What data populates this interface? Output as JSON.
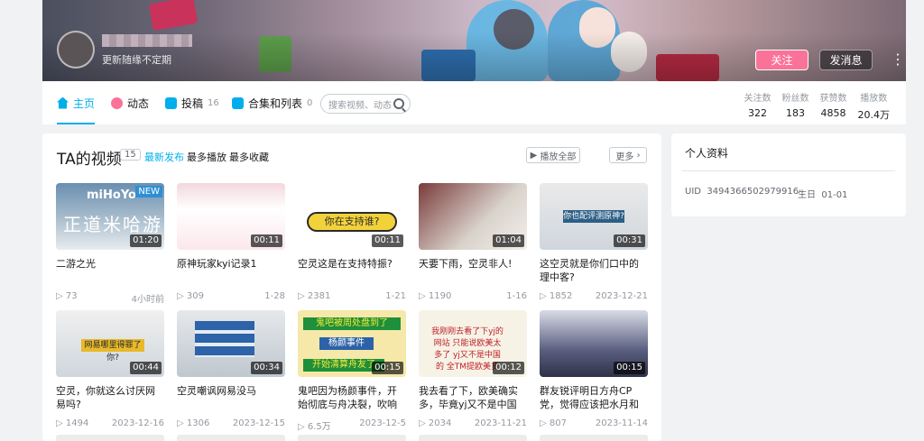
{
  "header": {
    "signature": "更新随缘不定期",
    "follow_label": "关注",
    "message_label": "发消息",
    "more_icon": "more-vertical-icon"
  },
  "nav": {
    "tabs": [
      {
        "label": "主页",
        "count": "",
        "icon": "home-icon",
        "active": true
      },
      {
        "label": "动态",
        "count": "",
        "icon": "dynamic-icon",
        "active": false
      },
      {
        "label": "投稿",
        "count": "16",
        "icon": "upload-icon",
        "active": false
      },
      {
        "label": "合集和列表",
        "count": "0",
        "icon": "collection-icon",
        "active": false
      }
    ],
    "search_placeholder": "搜索视频、动态",
    "stats": [
      {
        "label": "关注数",
        "value": "322"
      },
      {
        "label": "粉丝数",
        "value": "183"
      },
      {
        "label": "获赞数",
        "value": "4858"
      },
      {
        "label": "播放数",
        "value": "20.4万"
      }
    ]
  },
  "videos": {
    "title": "TA的视频",
    "count": "15",
    "filters": [
      "最新发布",
      "最多播放",
      "最多收藏"
    ],
    "play_all": "播放全部",
    "more": "更多",
    "items": [
      {
        "title": "二游之光",
        "duration": "01:20",
        "plays": "73",
        "date": "4小时前",
        "badge": "NEW",
        "thumb_text": "正道米哈游",
        "thumb_logo": "miHoYo"
      },
      {
        "title": "原神玩家kyi记录1",
        "duration": "00:11",
        "plays": "309",
        "date": "1-28"
      },
      {
        "title": "空灵这是在支持特振?",
        "duration": "00:11",
        "plays": "2381",
        "date": "1-21",
        "thumb_text": "你在支持谁?"
      },
      {
        "title": "天要下雨，空灵非人!",
        "duration": "01:04",
        "plays": "1190",
        "date": "1-16"
      },
      {
        "title": "这空灵就是你们口中的理中客?",
        "duration": "00:31",
        "plays": "1852",
        "date": "2023-12-21",
        "thumb_text": "你也配评测原神?"
      },
      {
        "title": "空灵，你就这么讨厌网易吗?",
        "duration": "00:44",
        "plays": "1494",
        "date": "2023-12-16",
        "thumb_text": "网易哪里得罪了你?"
      },
      {
        "title": "空灵嘲讽网易没马",
        "duration": "00:34",
        "plays": "1306",
        "date": "2023-12-15"
      },
      {
        "title": "鬼吧因为杨颜事件，开始彻底与舟决裂，吹响反黑的号角!",
        "duration": "00:15",
        "plays": "6.5万",
        "date": "2023-12-5",
        "thumb_l1": "鬼吧被周处盘到了",
        "thumb_l2": "杨颜事件",
        "thumb_l3": "开始清算舟友了"
      },
      {
        "title": "我去看了下，欧美确实多，毕竟yj又不是中国的!",
        "duration": "00:12",
        "plays": "2034",
        "date": "2023-11-21",
        "thumb_text": "我刚刚去看了下yj的网站 只能说欧美太多了 yj又不是中国的 全TM提欧美货"
      },
      {
        "title": "群友锐评明日方舟CP党，觉得应该把水月和瓶子凑CP!",
        "duration": "00:15",
        "plays": "807",
        "date": "2023-11-14"
      }
    ]
  },
  "profile": {
    "title": "个人资料",
    "uid_label": "UID",
    "uid": "3494366502979916",
    "birthday_label": "生日",
    "birthday": "01-01"
  }
}
